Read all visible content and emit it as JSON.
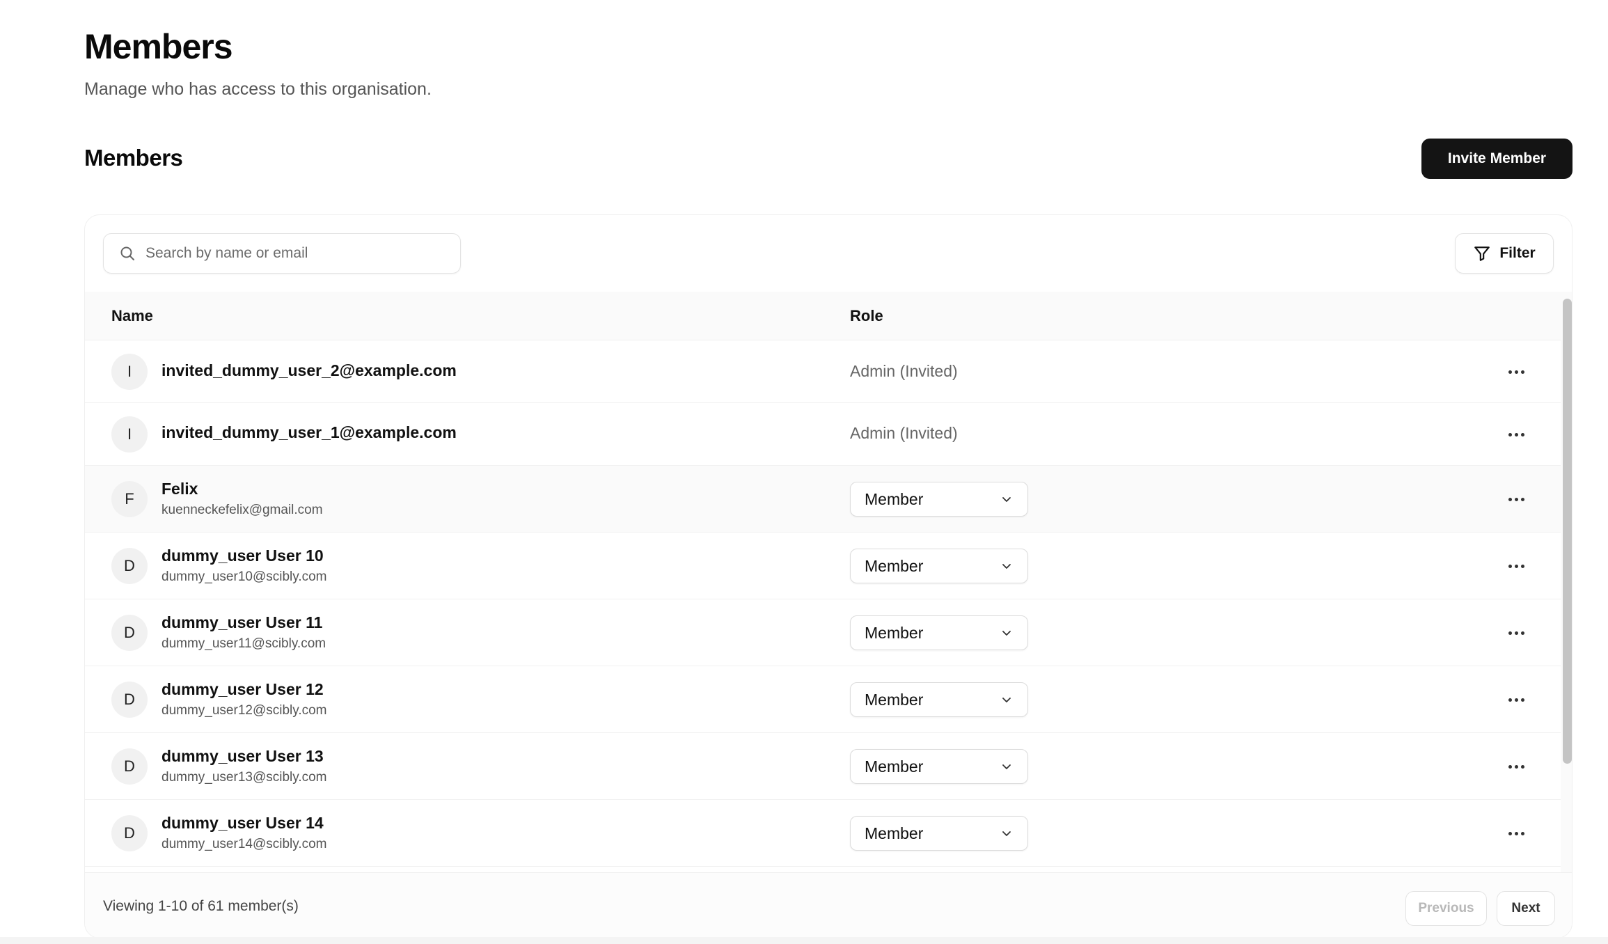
{
  "header": {
    "title": "Members",
    "subtitle": "Manage who has access to this organisation."
  },
  "section": {
    "title": "Members",
    "invite_label": "Invite Member"
  },
  "toolbar": {
    "search_placeholder": "Search by name or email",
    "filter_label": "Filter"
  },
  "table": {
    "columns": {
      "name": "Name",
      "role": "Role"
    },
    "rows": [
      {
        "initial": "I",
        "name": "invited_dummy_user_2@example.com",
        "email": "",
        "role": "Admin (Invited)",
        "role_type": "text"
      },
      {
        "initial": "I",
        "name": "invited_dummy_user_1@example.com",
        "email": "",
        "role": "Admin (Invited)",
        "role_type": "text"
      },
      {
        "initial": "F",
        "name": "Felix",
        "email": "kuenneckefelix@gmail.com",
        "role": "Member",
        "role_type": "select"
      },
      {
        "initial": "D",
        "name": "dummy_user User 10",
        "email": "dummy_user10@scibly.com",
        "role": "Member",
        "role_type": "select"
      },
      {
        "initial": "D",
        "name": "dummy_user User 11",
        "email": "dummy_user11@scibly.com",
        "role": "Member",
        "role_type": "select"
      },
      {
        "initial": "D",
        "name": "dummy_user User 12",
        "email": "dummy_user12@scibly.com",
        "role": "Member",
        "role_type": "select"
      },
      {
        "initial": "D",
        "name": "dummy_user User 13",
        "email": "dummy_user13@scibly.com",
        "role": "Member",
        "role_type": "select"
      },
      {
        "initial": "D",
        "name": "dummy_user User 14",
        "email": "dummy_user14@scibly.com",
        "role": "Member",
        "role_type": "select"
      }
    ]
  },
  "pagination": {
    "summary": "Viewing 1-10 of 61 member(s)",
    "previous_label": "Previous",
    "next_label": "Next"
  },
  "icons": {
    "search": "search-icon",
    "filter": "filter-icon",
    "chevron": "chevron-down-icon",
    "more": "more-horizontal-icon"
  },
  "colors": {
    "primary_button": "#141414",
    "muted_text": "#666666",
    "border": "#e3e3e3"
  }
}
